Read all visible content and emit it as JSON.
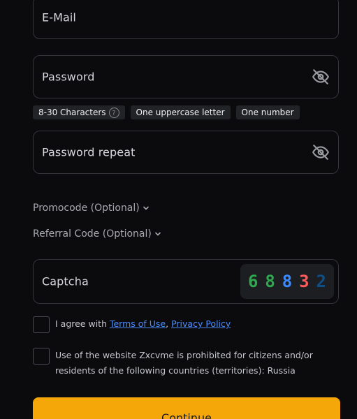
{
  "form": {
    "email": {
      "placeholder": "E-Mail"
    },
    "password": {
      "placeholder": "Password"
    },
    "password_hints": [
      "8-30 Characters",
      "One uppercase letter",
      "One number"
    ],
    "password_repeat": {
      "placeholder": "Password repeat"
    },
    "promocode_toggle": "Promocode (Optional)",
    "referral_toggle": "Referral Code (Optional)",
    "captcha": {
      "placeholder": "Captcha",
      "digits": [
        "6",
        "8",
        "8",
        "3",
        "2"
      ],
      "digit_colors": [
        "#2fa84f",
        "#2fa84f",
        "#3b8bff",
        "#ff5b5b",
        "#0e4f86"
      ]
    },
    "terms": {
      "prefix": "I agree with ",
      "terms_link": "Terms of Use",
      "separator": ", ",
      "privacy_link": "Privacy Policy"
    },
    "restriction_text": "Use of the website Zxcvme is prohibited for citizens and/or residents of the following countries (territories): Russia",
    "continue_label": "Continue"
  },
  "icons": {
    "password_toggle": "eye-off-icon",
    "hint_help": "question-circle-icon",
    "toggle_chevron": "chevron-down-icon"
  },
  "colors": {
    "accent": "#f5a70a",
    "link": "#4a8cff",
    "background": "#0b0b0d"
  }
}
